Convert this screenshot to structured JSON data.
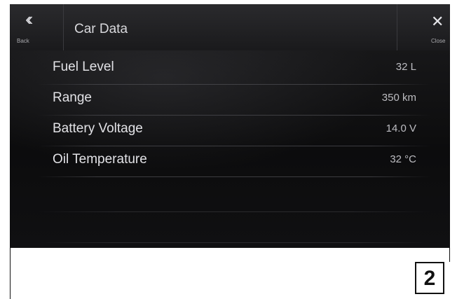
{
  "header": {
    "back_label": "Back",
    "title": "Car Data",
    "close_label": "Close"
  },
  "rows": [
    {
      "label": "Fuel Level",
      "value": "32 L"
    },
    {
      "label": "Range",
      "value": "350 km"
    },
    {
      "label": "Battery Voltage",
      "value": "14.0 V"
    },
    {
      "label": "Oil Temperature",
      "value": "32 °C"
    }
  ],
  "page_number": "2",
  "icons": {
    "back": "double-chevron-left-icon",
    "close": "close-icon"
  },
  "colors": {
    "screen_background": "#0b0b0c",
    "text_primary": "#e2e2e6",
    "text_secondary": "#bdbdc2"
  }
}
